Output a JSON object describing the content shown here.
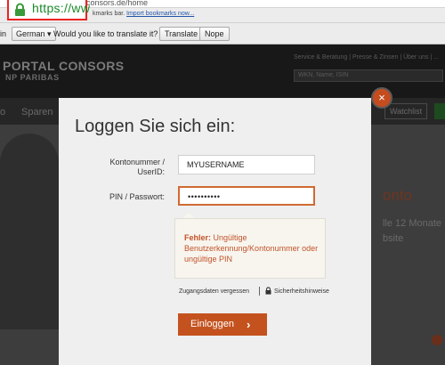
{
  "browser": {
    "url_visible": "https://ww",
    "url_rest": "consors.de/home",
    "bookmarks_text": "kmarks bar.",
    "import_link": "Import bookmarks now..."
  },
  "translate_bar": {
    "prefix": "in",
    "language": "German ▾",
    "question": "Would you like to translate it?",
    "translate_label": "Translate",
    "nope_label": "Nope"
  },
  "page": {
    "logo": "PORTAL CONSORS",
    "logo_sub": "NP PARIBAS",
    "header_links": "Service & Beratung | Presse & Zinsen | Über uns | ...",
    "search_placeholder": "WKN, Name, ISIN",
    "nav": [
      "o",
      "Sparen"
    ],
    "watchlist": "Watchlist",
    "hero_title": "onto",
    "hero_line1": "lle 12 Monate",
    "hero_line2": "bsite"
  },
  "modal": {
    "close_symbol": "×",
    "title": "Loggen Sie sich ein:",
    "username_label_line1": "Kontonummer /",
    "username_label_line2": "UserID:",
    "username_value": "MYUSERNAME",
    "pin_label": "PIN / Passwort:",
    "pin_value": "••••••••••",
    "error_prefix": "Fehler:",
    "error_message": "Ungültige Benutzerkennung/Kontonummer oder ungültige PIN",
    "forgot_link": "Zugangsdaten vergessen",
    "security_link": "Sicherheitshinweise",
    "login_label": "Einloggen",
    "login_chevron": "›"
  },
  "colors": {
    "accent": "#c4521f",
    "https_green": "#1a8a28",
    "highlight_red": "#ee2222"
  },
  "icons": {
    "lock": "padlock-icon",
    "close": "close-icon",
    "chevron": "chevron-right-icon"
  }
}
